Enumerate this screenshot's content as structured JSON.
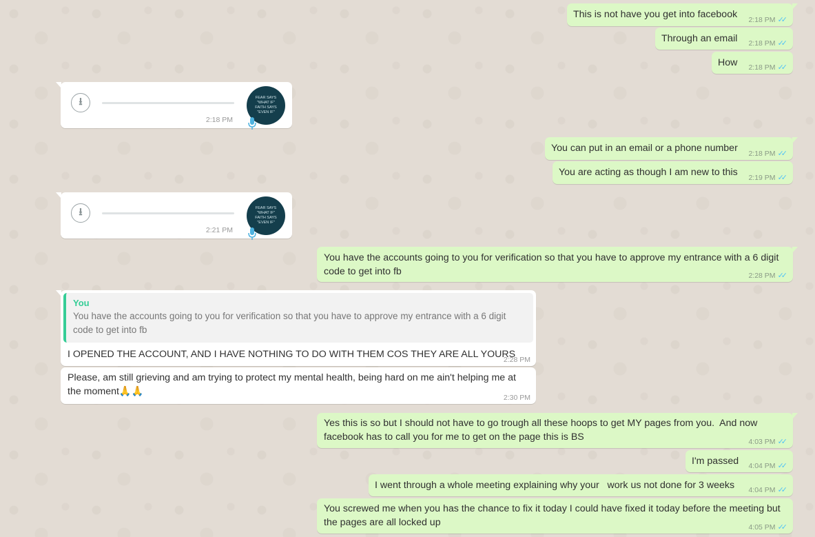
{
  "colors": {
    "outgoing": "#dcf8c6",
    "incoming": "#ffffff",
    "read_ticks": "#4fc3f7",
    "quote_accent": "#35cd96"
  },
  "messages": [
    {
      "text": "This is not have you get into facebook",
      "time": "2:18 PM"
    },
    {
      "text": "Through an email",
      "time": "2:18 PM"
    },
    {
      "text": "How",
      "time": "2:18 PM"
    },
    {
      "time": "2:18 PM",
      "avatar_text": "FEAR SAYS \"WHAT IF\" FAITH SAYS \"EVEN IF\""
    },
    {
      "text": "You can put in an email or a phone number",
      "time": "2:18 PM"
    },
    {
      "text": "You are acting as though I am new to this",
      "time": "2:19 PM"
    },
    {
      "time": "2:21 PM",
      "avatar_text": "FEAR SAYS \"WHAT IF\" FAITH SAYS \"EVEN IF\""
    },
    {
      "text": "You have the accounts going to you for verification so that you have to approve my entrance with a 6 digit code to get into fb",
      "time": "2:28 PM"
    },
    {
      "quote_author": "You",
      "quote_text": "You have the accounts going to you for verification so that you have to approve my entrance with a 6 digit code to get into fb",
      "text": "I OPENED THE ACCOUNT, AND I HAVE NOTHING TO DO WITH THEM COS THEY ARE ALL YOURS",
      "time": "2:28 PM"
    },
    {
      "text": "Please, am still grieving and am trying to protect my mental health, being hard on me ain't helping me at the moment🙏🙏",
      "time": "2:30 PM"
    },
    {
      "text": "Yes this is so but I should not have to go trough all these hoops to get MY pages from you.  And now facebook has to call you for me to get on the page this is BS",
      "time": "4:03 PM"
    },
    {
      "text": "I'm passed",
      "time": "4:04 PM"
    },
    {
      "text": "I went through a whole meeting explaining why your   work us not done for 3 weeks",
      "time": "4:04 PM"
    },
    {
      "text": "You screwed me when you has the chance to fix it today I could have fixed it today before the meeting but the pages are all locked up",
      "time": "4:05 PM"
    }
  ]
}
